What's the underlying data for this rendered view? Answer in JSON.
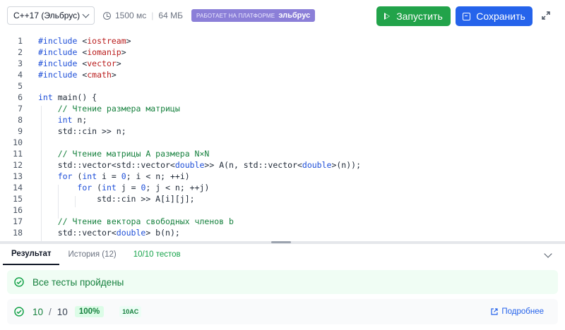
{
  "toolbar": {
    "language": "C++17 (Эльбрус)",
    "time_limit": "1500 мс",
    "memory_limit": "64 МБ",
    "platform_prefix": "РАБОТАЕТ НА ПЛАТФОРМЕ",
    "platform_name": "эльбрус",
    "run_label": "Запустить",
    "save_label": "Сохранить",
    "icons": {
      "clock": "clock-icon",
      "play": "play-icon",
      "save": "save-icon",
      "expand": "expand-icon"
    }
  },
  "editor": {
    "lines": [
      {
        "num": "1",
        "text": "#include <iostream>"
      },
      {
        "num": "2",
        "text": "#include <iomanip>"
      },
      {
        "num": "3",
        "text": "#include <vector>"
      },
      {
        "num": "4",
        "text": "#include <cmath>"
      },
      {
        "num": "5",
        "text": ""
      },
      {
        "num": "6",
        "text": "int main() {"
      },
      {
        "num": "7",
        "text": "    // Чтение размера матрицы"
      },
      {
        "num": "8",
        "text": "    int n;"
      },
      {
        "num": "9",
        "text": "    std::cin >> n;"
      },
      {
        "num": "10",
        "text": ""
      },
      {
        "num": "11",
        "text": "    // Чтение матрицы A размера N×N"
      },
      {
        "num": "12",
        "text": "    std::vector<std::vector<double>> A(n, std::vector<double>(n));"
      },
      {
        "num": "13",
        "text": "    for (int i = 0; i < n; ++i)"
      },
      {
        "num": "14",
        "text": "        for (int j = 0; j < n; ++j)"
      },
      {
        "num": "15",
        "text": "            std::cin >> A[i][j];"
      },
      {
        "num": "16",
        "text": ""
      },
      {
        "num": "17",
        "text": "    // Чтение вектора свободных членов b"
      },
      {
        "num": "18",
        "text": "    std::vector<double> b(n);"
      }
    ]
  },
  "results": {
    "tabs": {
      "result": "Результат",
      "history": "История (12)",
      "tests": "10/10 тестов"
    },
    "success_message": "Все тесты пройдены",
    "passed": "10",
    "slash": "/",
    "total": "10",
    "percent": "100%",
    "verdict_badge": "10AC",
    "details_link": "Подробнее"
  },
  "colors": {
    "run_button": "#22a34a",
    "save_button": "#2563eb",
    "platform_badge": "#8b7fd8",
    "success_text": "#15803d",
    "success_bg": "#f0fdf4"
  }
}
